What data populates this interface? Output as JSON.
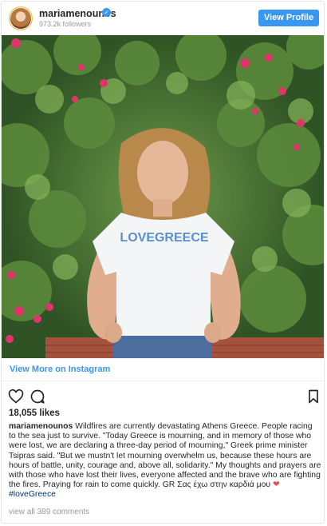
{
  "header": {
    "username": "mariamenounos",
    "verified_icon": "verified-badge-icon",
    "followers": "973.2k followers",
    "view_profile_label": "View Profile"
  },
  "post": {
    "image_shirt_text": "LOVEGREECE",
    "view_more_label": "View More on Instagram",
    "likes": "18,055 likes",
    "caption_user": "mariamenounos",
    "caption_text": " Wildfires are currently devastating Athens Greece. People racing to the sea just to survive. \"Today Greece is mourning, and in memory of those who were lost, we are declaring a three-day period of mourning,\" Greek prime minister Tsipras said. \"But we mustn't let mourning overwhelm us, because these hours are hours of battle, unity, courage and, above all, solidarity.\" My thoughts and prayers are with those who have lost their lives, everyone affected and the brave who are fighting the fires. Praying for rain to come quickly. ",
    "caption_greek": "GR Σας έχω στην καρδιά μου ",
    "caption_heart": "❤",
    "caption_hashtag": "#loveGreece",
    "comments_label": "view all 389 comments"
  },
  "colors": {
    "accent": "#3897f0",
    "heart": "#ed4956",
    "text": "#262626",
    "muted": "#999999"
  }
}
